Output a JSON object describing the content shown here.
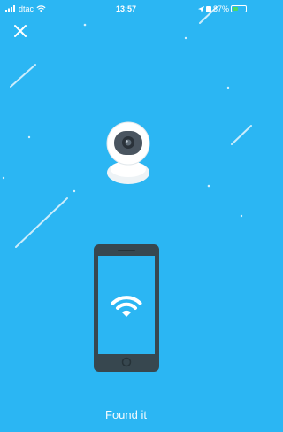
{
  "status_bar": {
    "carrier": "dtac",
    "time": "13:57",
    "battery_percent_label": "87%"
  },
  "icons": {
    "close": "close-icon",
    "camera": "security-camera-icon",
    "phone": "smartphone-icon",
    "wifi": "wifi-icon"
  },
  "colors": {
    "background": "#2bb6f3",
    "phone_body": "#37474f",
    "phone_screen": "#2bb6f3",
    "battery_charge": "#4cd964"
  },
  "footer": {
    "found_label": "Found it"
  }
}
